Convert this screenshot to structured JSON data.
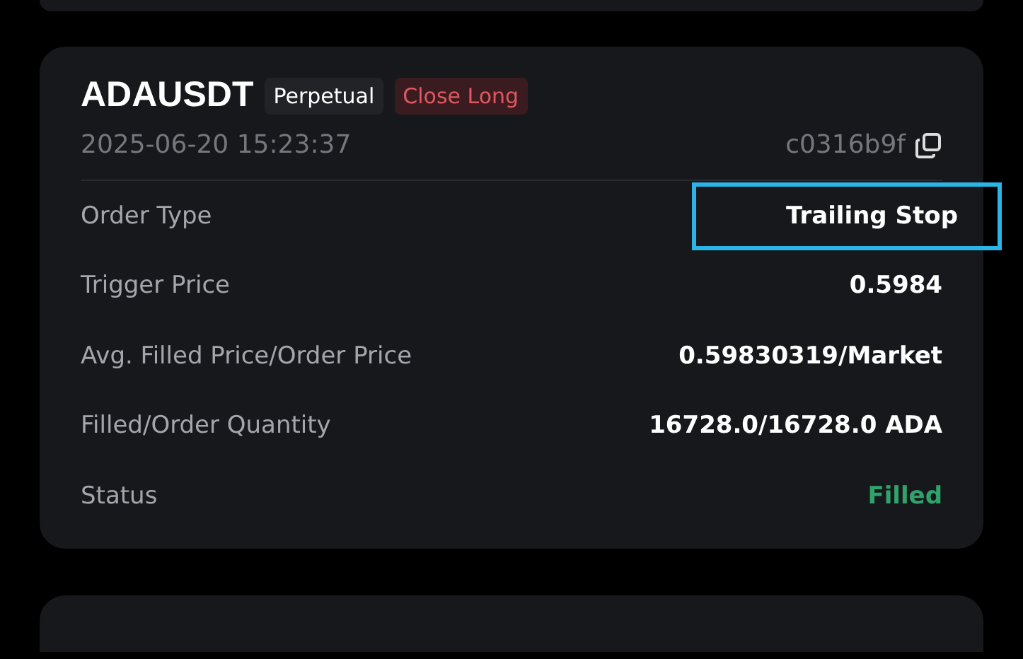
{
  "order": {
    "symbol": "ADAUSDT",
    "tags": [
      {
        "label": "Perpetual",
        "kind": "neutral"
      },
      {
        "label": "Close Long",
        "kind": "sell"
      }
    ],
    "time": "2025-06-20 15:23:37",
    "order_id": "c0316b9f",
    "rows": [
      {
        "label": "Order Type",
        "value": "Trailing Stop",
        "kind": "plain",
        "highlighted": true
      },
      {
        "label": "Trigger Price",
        "value": "0.5984",
        "kind": "plain",
        "highlighted": false
      },
      {
        "label": "Avg. Filled Price/Order Price",
        "value": "0.59830319/Market",
        "kind": "plain",
        "highlighted": false
      },
      {
        "label": "Filled/Order Quantity",
        "value": "16728.0/16728.0 ADA",
        "kind": "plain",
        "highlighted": false
      },
      {
        "label": "Status",
        "value": "Filled",
        "kind": "success",
        "highlighted": false
      }
    ]
  }
}
